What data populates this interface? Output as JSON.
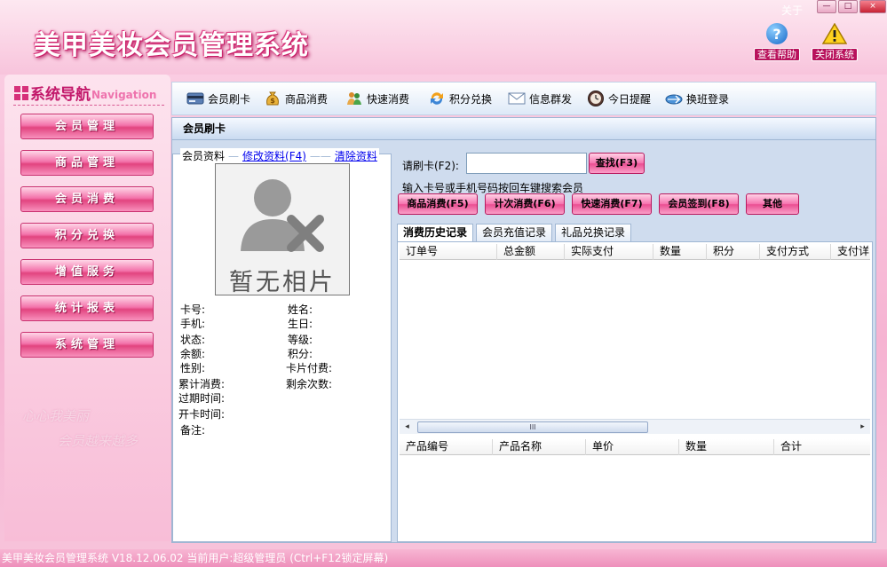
{
  "app": {
    "title": "美甲美妆会员管理系统",
    "about": "关于"
  },
  "window_controls": {
    "minimize": "—",
    "maximize": "□",
    "close": "×"
  },
  "top_actions": [
    {
      "label": "查看帮助",
      "icon": "help-icon"
    },
    {
      "label": "关闭系统",
      "icon": "warning-icon"
    }
  ],
  "nav": {
    "title": "系统导航",
    "subtitle": "Navigation",
    "items": [
      "会员管理",
      "商品管理",
      "会员消费",
      "积分兑换",
      "增值服务",
      "统计报表",
      "系统管理"
    ],
    "decor_line1": "心心我美丽",
    "decor_line2": "会员越来越多"
  },
  "toolbar": {
    "items": [
      {
        "label": "会员刷卡",
        "icon": "card-icon"
      },
      {
        "label": "商品消费",
        "icon": "money-bag-icon"
      },
      {
        "label": "快速消费",
        "icon": "people-icon"
      },
      {
        "label": "积分兑换",
        "icon": "exchange-icon"
      },
      {
        "label": "信息群发",
        "icon": "mail-icon"
      },
      {
        "label": "今日提醒",
        "icon": "clock-icon"
      },
      {
        "label": "换班登录",
        "icon": "shift-login-icon"
      }
    ]
  },
  "panel": {
    "title": "会员刷卡"
  },
  "member": {
    "legend": "会员资料",
    "edit_link": "修改资料(F4)",
    "clear_link": "清除资料",
    "photo_text": "暂无相片",
    "fields_left": [
      "卡号:",
      "手机:",
      "状态:",
      "余额:",
      "性别:",
      "累计消费:",
      "过期时间:",
      "开卡时间:",
      "备注:"
    ],
    "fields_right": [
      "姓名:",
      "生日:",
      "等级:",
      "积分:",
      "卡片付费:",
      "剩余次数:"
    ]
  },
  "swipe": {
    "label": "请刷卡(F2):",
    "value": "",
    "search_button": "查找(F3)",
    "hint": "输入卡号或手机号码按回车键搜索会员"
  },
  "actions": [
    "商品消费(F5)",
    "计次消费(F6)",
    "快速消费(F7)",
    "会员签到(F8)",
    "其他"
  ],
  "tabs": [
    {
      "label": "消费历史记录",
      "active": true
    },
    {
      "label": "会员充值记录",
      "active": false
    },
    {
      "label": "礼品兑换记录",
      "active": false
    }
  ],
  "history_table": {
    "columns": [
      "订单号",
      "总金额",
      "实际支付",
      "数量",
      "积分",
      "支付方式",
      "支付详"
    ],
    "rows": []
  },
  "scrollbar": {
    "left_arrow": "◂",
    "right_arrow": "▸",
    "grip": "III"
  },
  "detail_table": {
    "columns": [
      "产品编号",
      "产品名称",
      "单价",
      "数量",
      "合计"
    ],
    "rows": []
  },
  "status": {
    "text": "美甲美妆会员管理系统 V18.12.06.02 当前用户:超级管理员 (Ctrl+F12锁定屏幕)"
  },
  "colors": {
    "accent_pink": "#e84a8f",
    "nav_text": "#c2186a",
    "panel_blue": "#cfdcee"
  }
}
